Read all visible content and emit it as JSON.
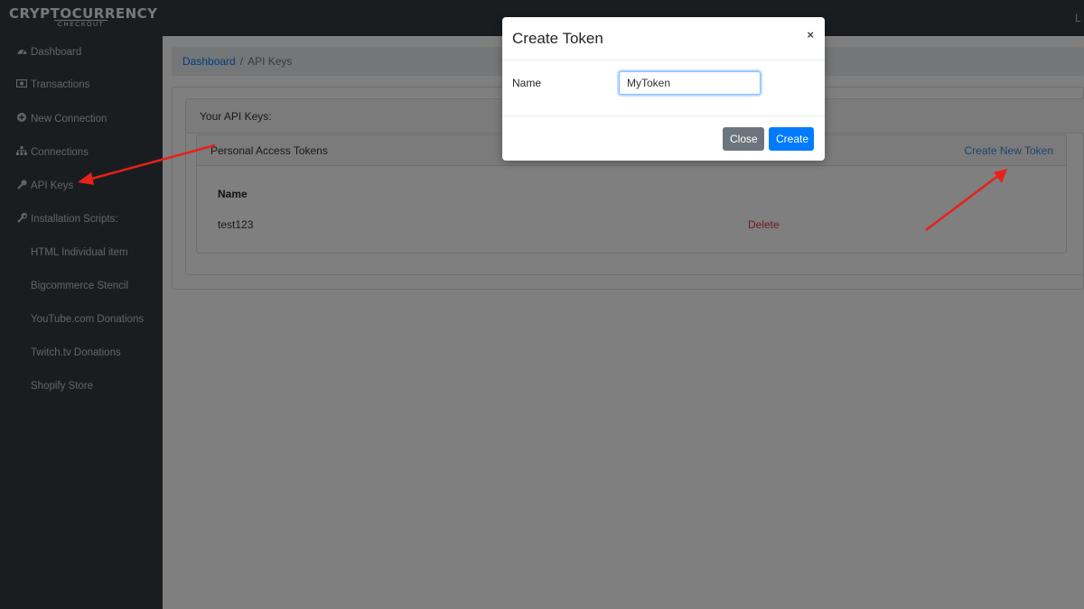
{
  "app": {
    "logo_main": "CRYPTOCURRENCY",
    "logo_sub": "CHECKOUT",
    "user_initial": "L"
  },
  "sidebar": {
    "items": [
      {
        "label": "Dashboard",
        "icon": "dashboard-icon"
      },
      {
        "label": "Transactions",
        "icon": "money-icon"
      },
      {
        "label": "New Connection",
        "icon": "plus-circle-icon"
      },
      {
        "label": "Connections",
        "icon": "sitemap-icon"
      },
      {
        "label": "API Keys",
        "icon": "key-icon"
      },
      {
        "label": "Installation Scripts:",
        "icon": "wrench-icon"
      }
    ],
    "sub_items": [
      {
        "label": "HTML Individual item"
      },
      {
        "label": "Bigcommerce Stencil"
      },
      {
        "label": "YouTube.com Donations"
      },
      {
        "label": "Twitch.tv Donations"
      },
      {
        "label": "Shopify Store"
      }
    ]
  },
  "breadcrumb": {
    "home": "Dashboard",
    "separator": "/",
    "current": "API Keys"
  },
  "api_keys": {
    "card_title": "Your API Keys:",
    "tokens_title": "Personal Access Tokens",
    "create_link": "Create New Token",
    "column_name": "Name",
    "rows": [
      {
        "name": "test123",
        "action": "Delete"
      }
    ]
  },
  "modal": {
    "title": "Create Token",
    "close_symbol": "×",
    "field_label": "Name",
    "field_value": "MyToken",
    "close_button": "Close",
    "create_button": "Create"
  },
  "colors": {
    "sidebar_bg": "#343a40",
    "link": "#007bff",
    "danger": "#dc3545",
    "secondary_button": "#6c757d",
    "primary_button": "#007bff",
    "annotation_arrow": "#e8201a"
  }
}
